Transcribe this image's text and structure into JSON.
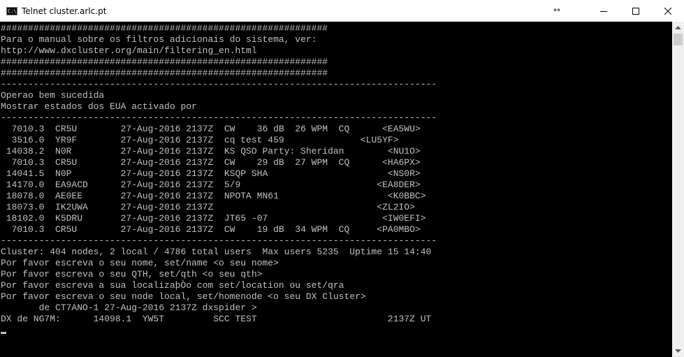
{
  "window": {
    "title": "Telnet cluster.arlc.pt",
    "app_icon_text": "C:\\",
    "resize_glyph": "↔"
  },
  "colors": {
    "console_bg": "#000000",
    "console_fg": "#c0c0c0",
    "titlebar_bg": "#ffffff",
    "scrollbar_bg": "#f0f0f0",
    "scrollbar_thumb": "#cdcdcd"
  },
  "terminal": {
    "lines": [
      "############################################################",
      "Para o manual sobre os filtros adicionais do sistema, ver:",
      "http://www.dxcluster.org/main/filtering_en.html",
      "############################################################",
      "############################################################",
      "--------------------------------------------------------------------------------",
      "Operao bem sucedida",
      "Mostrar estados dos EUA activado por",
      "--------------------------------------------------------------------------------",
      "  7010.3  CR5U        27-Aug-2016 2137Z  CW    36 dB  26 WPM  CQ      <EA5WU>",
      "  3516.0  YR9F        27-Aug-2016 2137Z  cq test 459              <LU5YF>",
      " 14038.2  N0R         27-Aug-2016 2137Z  KS QSO Party: Sheridan        <NU1O>",
      "  7010.3  CR5U        27-Aug-2016 2137Z  CW    29 dB  27 WPM  CQ      <HA6PX>",
      " 14041.5  N0P         27-Aug-2016 2137Z  KSQP SHA                      <NS0R>",
      " 14170.0  EA9ACD      27-Aug-2016 2137Z  5/9                         <EA8DER>",
      " 18078.0  AE0EE       27-Aug-2016 2137Z  NPOTA MN61                    <K0BBC>",
      " 18073.0  IK2UWA      27-Aug-2016 2137Z                              <ZL2IO>",
      " 18102.0  K5DRU       27-Aug-2016 2137Z  JT65 -07                     <IW0EFI>",
      "  7010.3  CR5U        27-Aug-2016 2137Z  CW    19 dB  34 WPM  CQ     <PA0MBO>",
      "--------------------------------------------------------------------------------",
      "Cluster: 404 nodes, 2 local / 4786 total users  Max users 5235  Uptime 15 14:40",
      "Por favor escreva o seu nome, set/name <o seu nome>",
      "Por favor escreva o seu QTH, set/qth <o seu qth>",
      "Por favor escreva a sua localizaþÒo com set/location ou set/qra",
      "Por favor escreva o seu node local, set/homenode <o seu DX Cluster>",
      "       de CT7ANO-1 27-Aug-2016 2137Z dxspider >",
      "DX de NG7M:      14098.1  YW5T         SCC TEST                        2137Z UT",
      ""
    ]
  }
}
